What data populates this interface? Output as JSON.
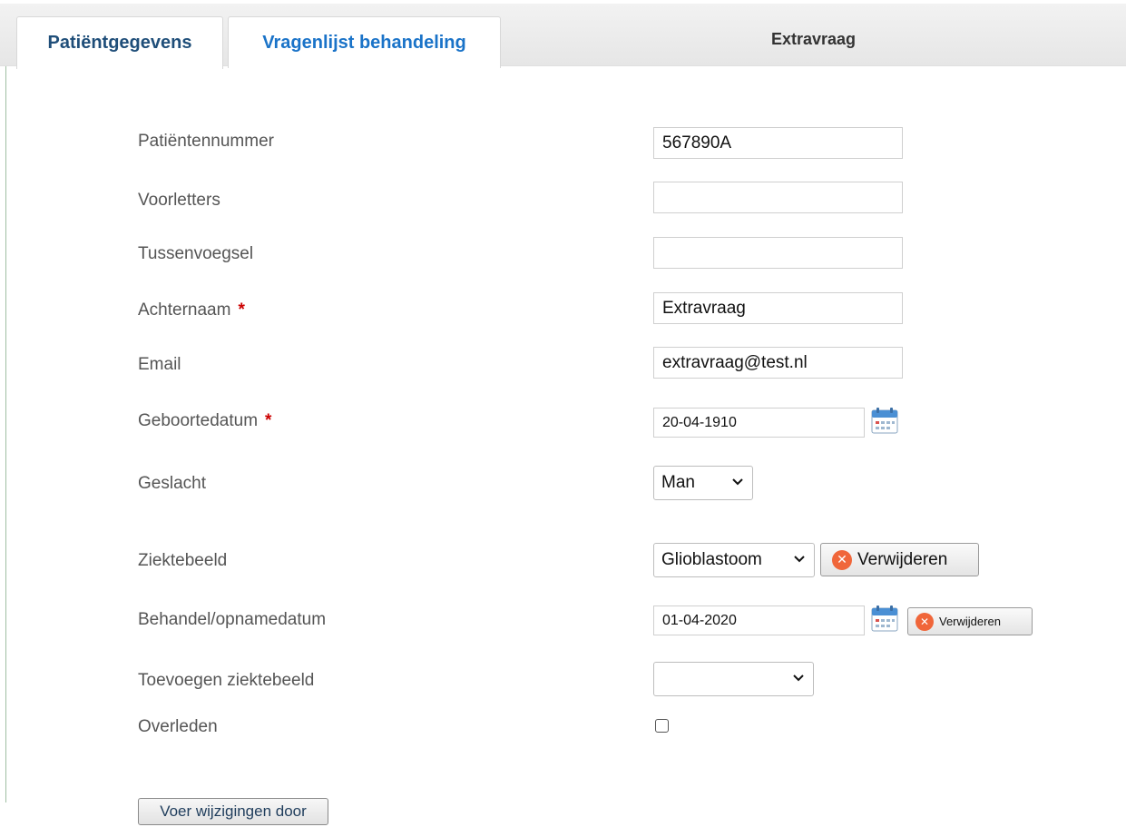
{
  "tabs": {
    "active_label": "Patiëntgegevens",
    "inactive_label": "Vragenlijst behandeling",
    "header_title": "Extravraag"
  },
  "form": {
    "patient_number": {
      "label": "Patiëntennummer",
      "value": "567890A"
    },
    "initials": {
      "label": "Voorletters",
      "value": ""
    },
    "infix": {
      "label": "Tussenvoegsel",
      "value": ""
    },
    "last_name": {
      "label": "Achternaam",
      "required_mark": "*",
      "value": "Extravraag"
    },
    "email": {
      "label": "Email",
      "value": "extravraag@test.nl"
    },
    "birth_date": {
      "label": "Geboortedatum",
      "required_mark": "*",
      "value": "20-04-1910"
    },
    "gender": {
      "label": "Geslacht",
      "selected": "Man"
    },
    "disease": {
      "label": "Ziektebeeld",
      "selected": "Glioblastoom",
      "remove_label": "Verwijderen"
    },
    "treatment_date": {
      "label": "Behandel/opnamedatum",
      "value": "01-04-2020",
      "remove_label": "Verwijderen"
    },
    "add_disease": {
      "label": "Toevoegen ziektebeeld",
      "selected": ""
    },
    "deceased": {
      "label": "Overleden",
      "checked": false
    },
    "submit_label": "Voer wijzigingen door"
  },
  "icons": {
    "calendar": "calendar-icon",
    "remove": "remove-x-icon",
    "dropdown": "chevron-down-icon"
  },
  "colors": {
    "active_tab_text": "#1f4e79",
    "inactive_tab_text": "#1a73c8",
    "required_mark": "#cc0000",
    "remove_icon": "#f0663a"
  }
}
